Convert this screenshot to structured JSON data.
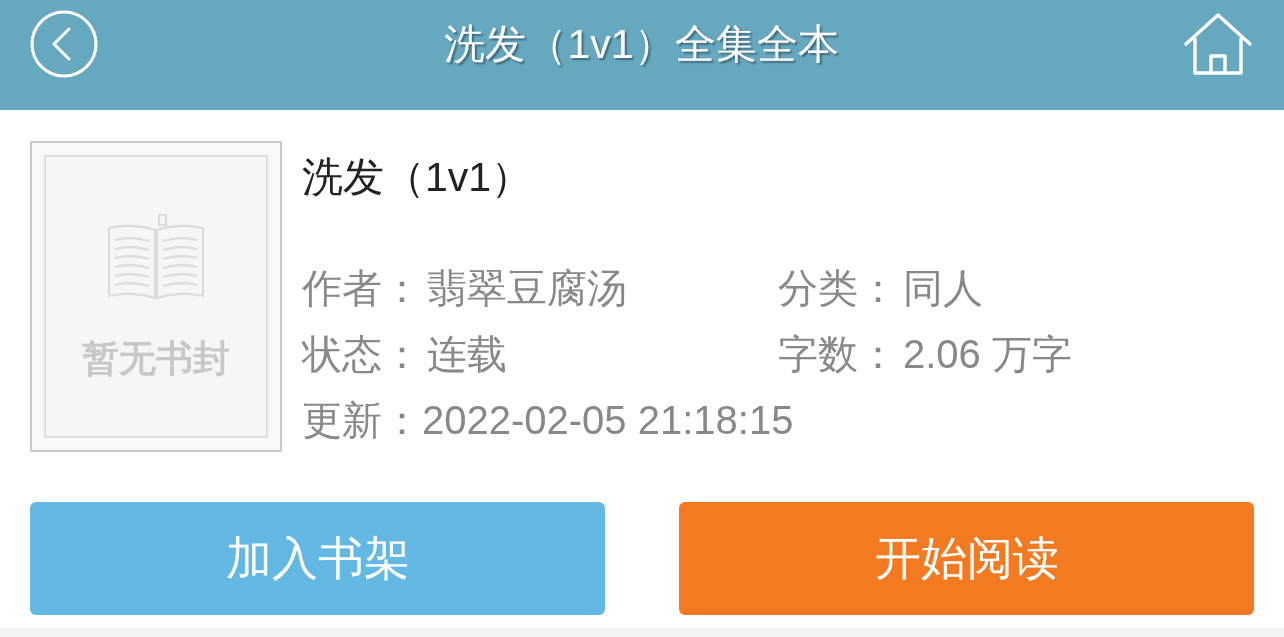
{
  "header": {
    "title": "洗发（1v1）全集全本"
  },
  "book": {
    "title": "洗发（1v1）",
    "cover": {
      "caption": "暂无书封"
    },
    "info": [
      {
        "label": "作者：",
        "value": "翡翠豆腐汤"
      },
      {
        "label": "分类：",
        "value": "同人"
      },
      {
        "label": "状态：",
        "value": "连载"
      },
      {
        "label": "字数：",
        "value": "2.06 万字"
      },
      {
        "label": "更新：",
        "value": "2022-02-05 21:18:15"
      }
    ]
  },
  "buttons": [
    {
      "label": "加入书架",
      "kind": "secondary"
    },
    {
      "label": "开始阅读",
      "kind": "primary"
    }
  ]
}
